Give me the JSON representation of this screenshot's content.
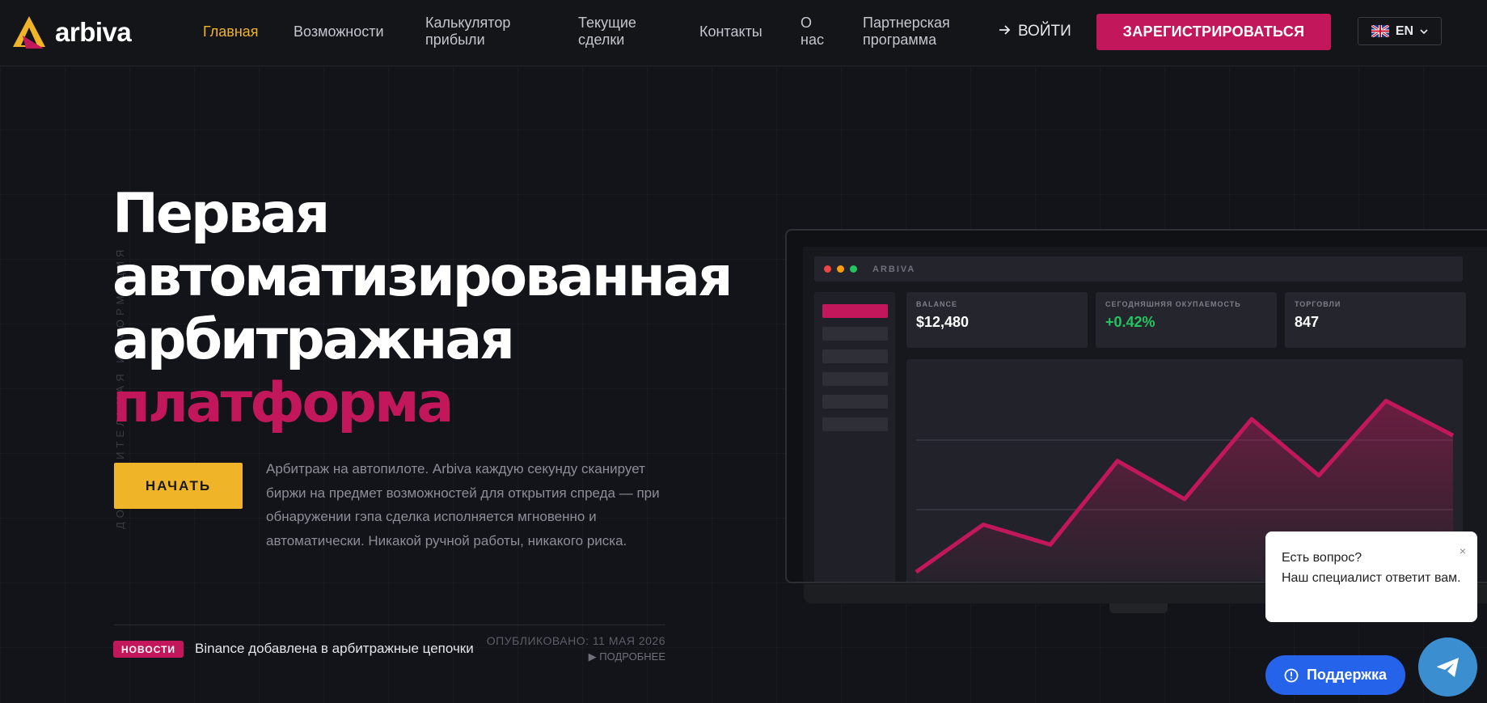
{
  "brand": {
    "name": "arbiva",
    "primary": "#c2185b",
    "accent": "#f0b429"
  },
  "nav": {
    "items": [
      {
        "label": "Главная",
        "active": true
      },
      {
        "label": "Возможности"
      },
      {
        "label": "Калькулятор\nприбыли"
      },
      {
        "label": "Текущие\nсделки"
      },
      {
        "label": "Контакты"
      },
      {
        "label": "О\nнас"
      },
      {
        "label": "Партнерская\nпрограмма"
      }
    ],
    "login_label": "ВОЙТИ",
    "register_label": "ЗАРЕГИСТРИРОВАТЬСЯ",
    "language": "EN"
  },
  "hero": {
    "vertical_caption": "ДОПОЛНИТЕЛЬНАЯ ИНФОРМАЦИЯ",
    "title_lines": [
      "Первая",
      "автоматизированная",
      "арбитражная"
    ],
    "title_accent": "платформа",
    "cta_label": "НАЧАТЬ",
    "description": "Арбитраж на автопилоте. Arbiva каждую секунду сканирует биржи на предмет возможностей для открытия спреда — при обнаружении гэпа сделка исполняется мгновенно и автоматически. Никакой ручной работы, никакого риска."
  },
  "news": {
    "badge": "НОВОСТИ",
    "text": "Binance добавлена в арбитражные цепочки",
    "date": "ОПУБЛИКОВАНО: 11 МАЯ 2026",
    "more": "▶ ПОДРОБНЕЕ"
  },
  "dashboard": {
    "app_title": "ARBIVA",
    "stats": [
      {
        "label": "BALANCE",
        "value": "$12,480"
      },
      {
        "label": "СЕГОДНЯШНЯЯ ОКУПАЕМОСТЬ",
        "value": "+0.42%",
        "positive": true
      },
      {
        "label": "ТОРГОВЛИ",
        "value": "847"
      }
    ],
    "line_color": "#c2185b"
  },
  "chart_data": {
    "type": "area",
    "x": [
      1,
      2,
      3,
      4,
      5,
      6,
      7,
      8,
      9
    ],
    "values": [
      12,
      38,
      27,
      73,
      52,
      96,
      65,
      106,
      87
    ],
    "ylim": [
      0,
      120
    ],
    "grid": true
  },
  "chat": {
    "line1": "Есть вопрос?",
    "line2": "Наш специалист ответит вам.",
    "close": "×",
    "support_label": "Поддержка"
  }
}
